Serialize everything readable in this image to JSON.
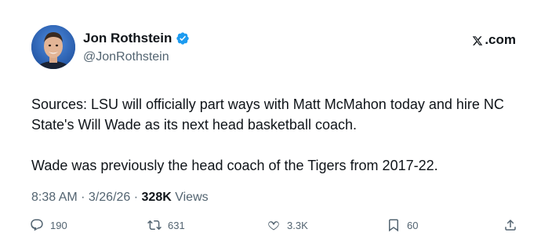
{
  "author": {
    "display_name": "Jon Rothstein",
    "handle": "@JonRothstein",
    "verified_icon": "verified-badge-icon",
    "avatar_icon": "profile-photo"
  },
  "brand": {
    "label": ".com",
    "icon": "x-logo-icon"
  },
  "tweet": {
    "paragraphs": [
      "Sources: LSU will officially part ways with Matt McMahon today and hire NC State's Will Wade as its next head basketball coach.",
      "Wade was previously the head coach of the Tigers from 2017-22."
    ]
  },
  "meta": {
    "time": "8:38 AM",
    "sep1": " · ",
    "date": "3/26/26",
    "sep2": " · ",
    "views_count": "328K",
    "views_label": " Views"
  },
  "actions": {
    "replies": "190",
    "reposts": "631",
    "likes": "3.3K",
    "bookmarks": "60"
  },
  "colors": {
    "text": "#0f1419",
    "secondary": "#536471",
    "verified": "#1d9bf0"
  }
}
